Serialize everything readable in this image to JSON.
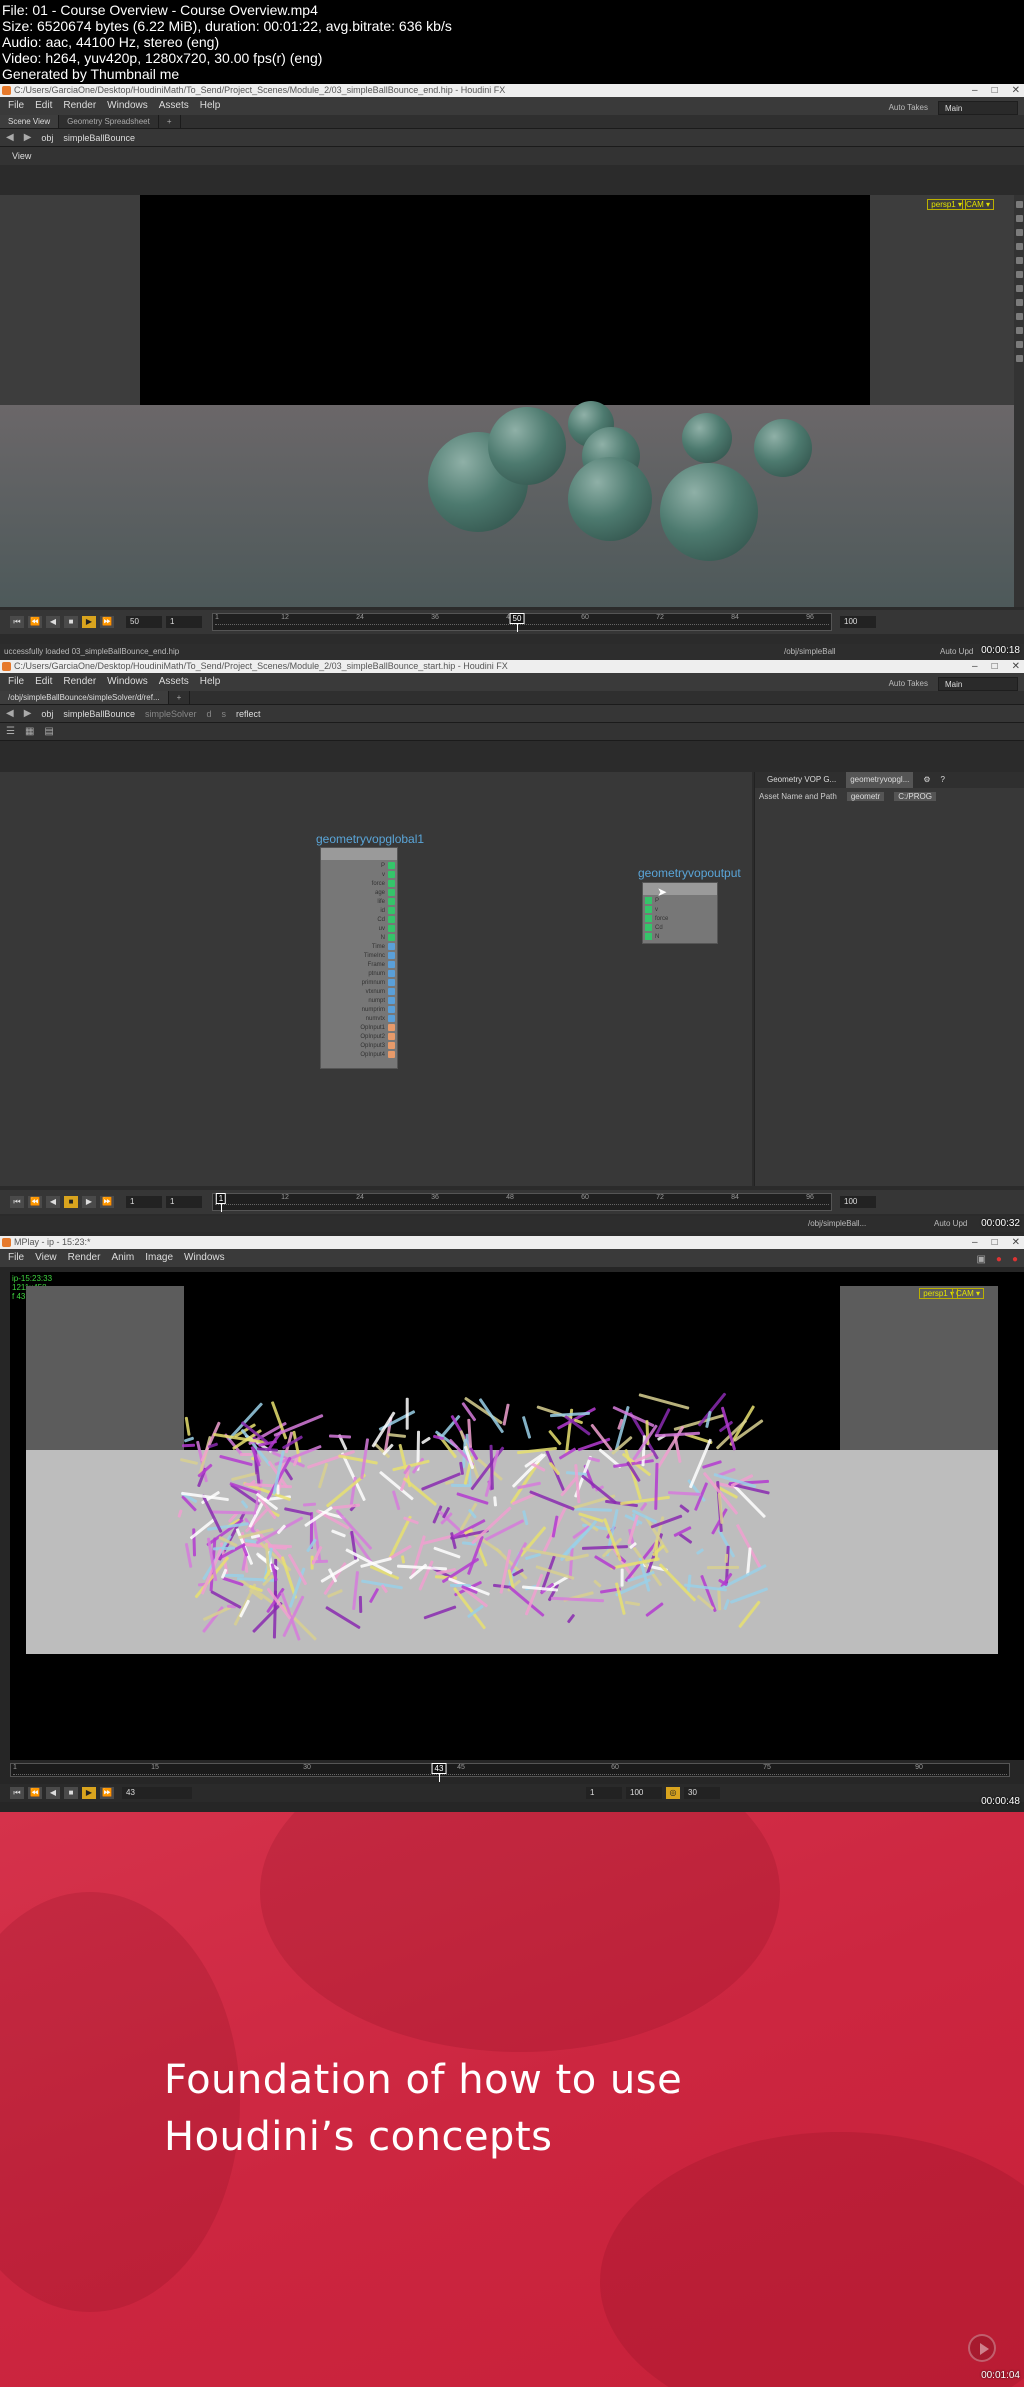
{
  "header": {
    "file": "File: 01 - Course Overview - Course Overview.mp4",
    "size": "Size: 6520674 bytes (6.22 MiB), duration: 00:01:22, avg.bitrate: 636 kb/s",
    "audio": "Audio: aac, 44100 Hz, stereo (eng)",
    "video": "Video: h264, yuv420p, 1280x720, 30.00 fps(r) (eng)",
    "generator": "Generated by Thumbnail me"
  },
  "frame1": {
    "window_title": "C:/Users/GarciaOne/Desktop/HoudiniMath/To_Send/Project_Scenes/Module_2/03_simpleBallBounce_end.hip - Houdini FX",
    "menu": [
      "File",
      "Edit",
      "Render",
      "Windows",
      "Assets",
      "Help"
    ],
    "auto_takes": "Auto Takes",
    "desktop": "Main",
    "tabs": [
      "Scene View",
      "Geometry Spreadsheet",
      "+"
    ],
    "path": {
      "root": "obj",
      "node": "simpleBallBounce"
    },
    "view_label": "View",
    "cam": {
      "persp": "persp1 ▾",
      "cam": "CAM ▾"
    },
    "timeline": {
      "frame": "50",
      "start": "1",
      "end": "100",
      "ticks": [
        "1",
        "12",
        "24",
        "36",
        "48",
        "60",
        "72",
        "84",
        "96"
      ],
      "current": "50"
    },
    "status": "uccessfully loaded 03_simpleBallBounce_end.hip",
    "status_path": "/obj/simpleBall",
    "auto_update": "Auto Upd",
    "timestamp": "00:00:18"
  },
  "frame2": {
    "window_title": "C:/Users/GarciaOne/Desktop/HoudiniMath/To_Send/Project_Scenes/Module_2/03_simpleBallBounce_start.hip - Houdini FX",
    "menu": [
      "File",
      "Edit",
      "Render",
      "Windows",
      "Assets",
      "Help"
    ],
    "auto_takes": "Auto Takes",
    "desktop": "Main",
    "tab": "/obj/simpleBallBounce/simpleSolver/d/ref...",
    "path": {
      "root": "obj",
      "node": "simpleBallBounce",
      "solver": "simpleSolver",
      "d": "d",
      "s": "s",
      "reflect": "reflect"
    },
    "node1": {
      "label": "geometryvopglobal1",
      "ports": [
        "P",
        "v",
        "force",
        "age",
        "life",
        "id",
        "Cd",
        "uv",
        "N",
        "Time",
        "TimeInc",
        "Frame",
        "ptnum",
        "primnum",
        "vtxnum",
        "numpt",
        "numprim",
        "numvtx",
        "OpInput1",
        "OpInput2",
        "OpInput3",
        "OpInput4"
      ]
    },
    "node2": {
      "label": "geometryvopoutput",
      "ports": [
        "P",
        "v",
        "force",
        "Cd",
        "N"
      ]
    },
    "parm": {
      "type": "Geometry VOP G...",
      "name": "geometryvopgl...",
      "asset_label": "Asset Name and Path",
      "asset_value": "geometr",
      "asset_path": "C:/PROG"
    },
    "timeline": {
      "frame": "1",
      "start": "1",
      "end": "100",
      "ticks": [
        "1",
        "12",
        "24",
        "36",
        "48",
        "60",
        "72",
        "84",
        "96"
      ],
      "current": "1"
    },
    "status_path": "/obj/simpleBall...",
    "auto_update": "Auto Upd",
    "timestamp": "00:00:32"
  },
  "frame3": {
    "window_title": "MPlay - ip - 15:23:*",
    "menu": [
      "File",
      "View",
      "Render",
      "Anim",
      "Image",
      "Windows"
    ],
    "info": [
      "ip-15:23:33",
      "1211x458",
      "f 43"
    ],
    "cam": {
      "persp": "persp1 ▾",
      "cam": "CAM ▾"
    },
    "timeline": {
      "frame": "43",
      "start": "1",
      "end": "100",
      "fps": "30",
      "ticks": [
        "1",
        "15",
        "30",
        "45",
        "60",
        "75",
        "90"
      ],
      "current": "43"
    },
    "timestamp": "00:00:48"
  },
  "frame4": {
    "headline_line1": "Foundation of how to use",
    "headline_line2": "Houdini’s concepts",
    "timestamp": "00:01:04"
  },
  "colors": {
    "accent_red": "#cc2640",
    "houdini_orange": "#e6792b",
    "play_yellow": "#d9a41e",
    "node_label_blue": "#5aa5d8",
    "mplay_green": "#3fd43f"
  }
}
